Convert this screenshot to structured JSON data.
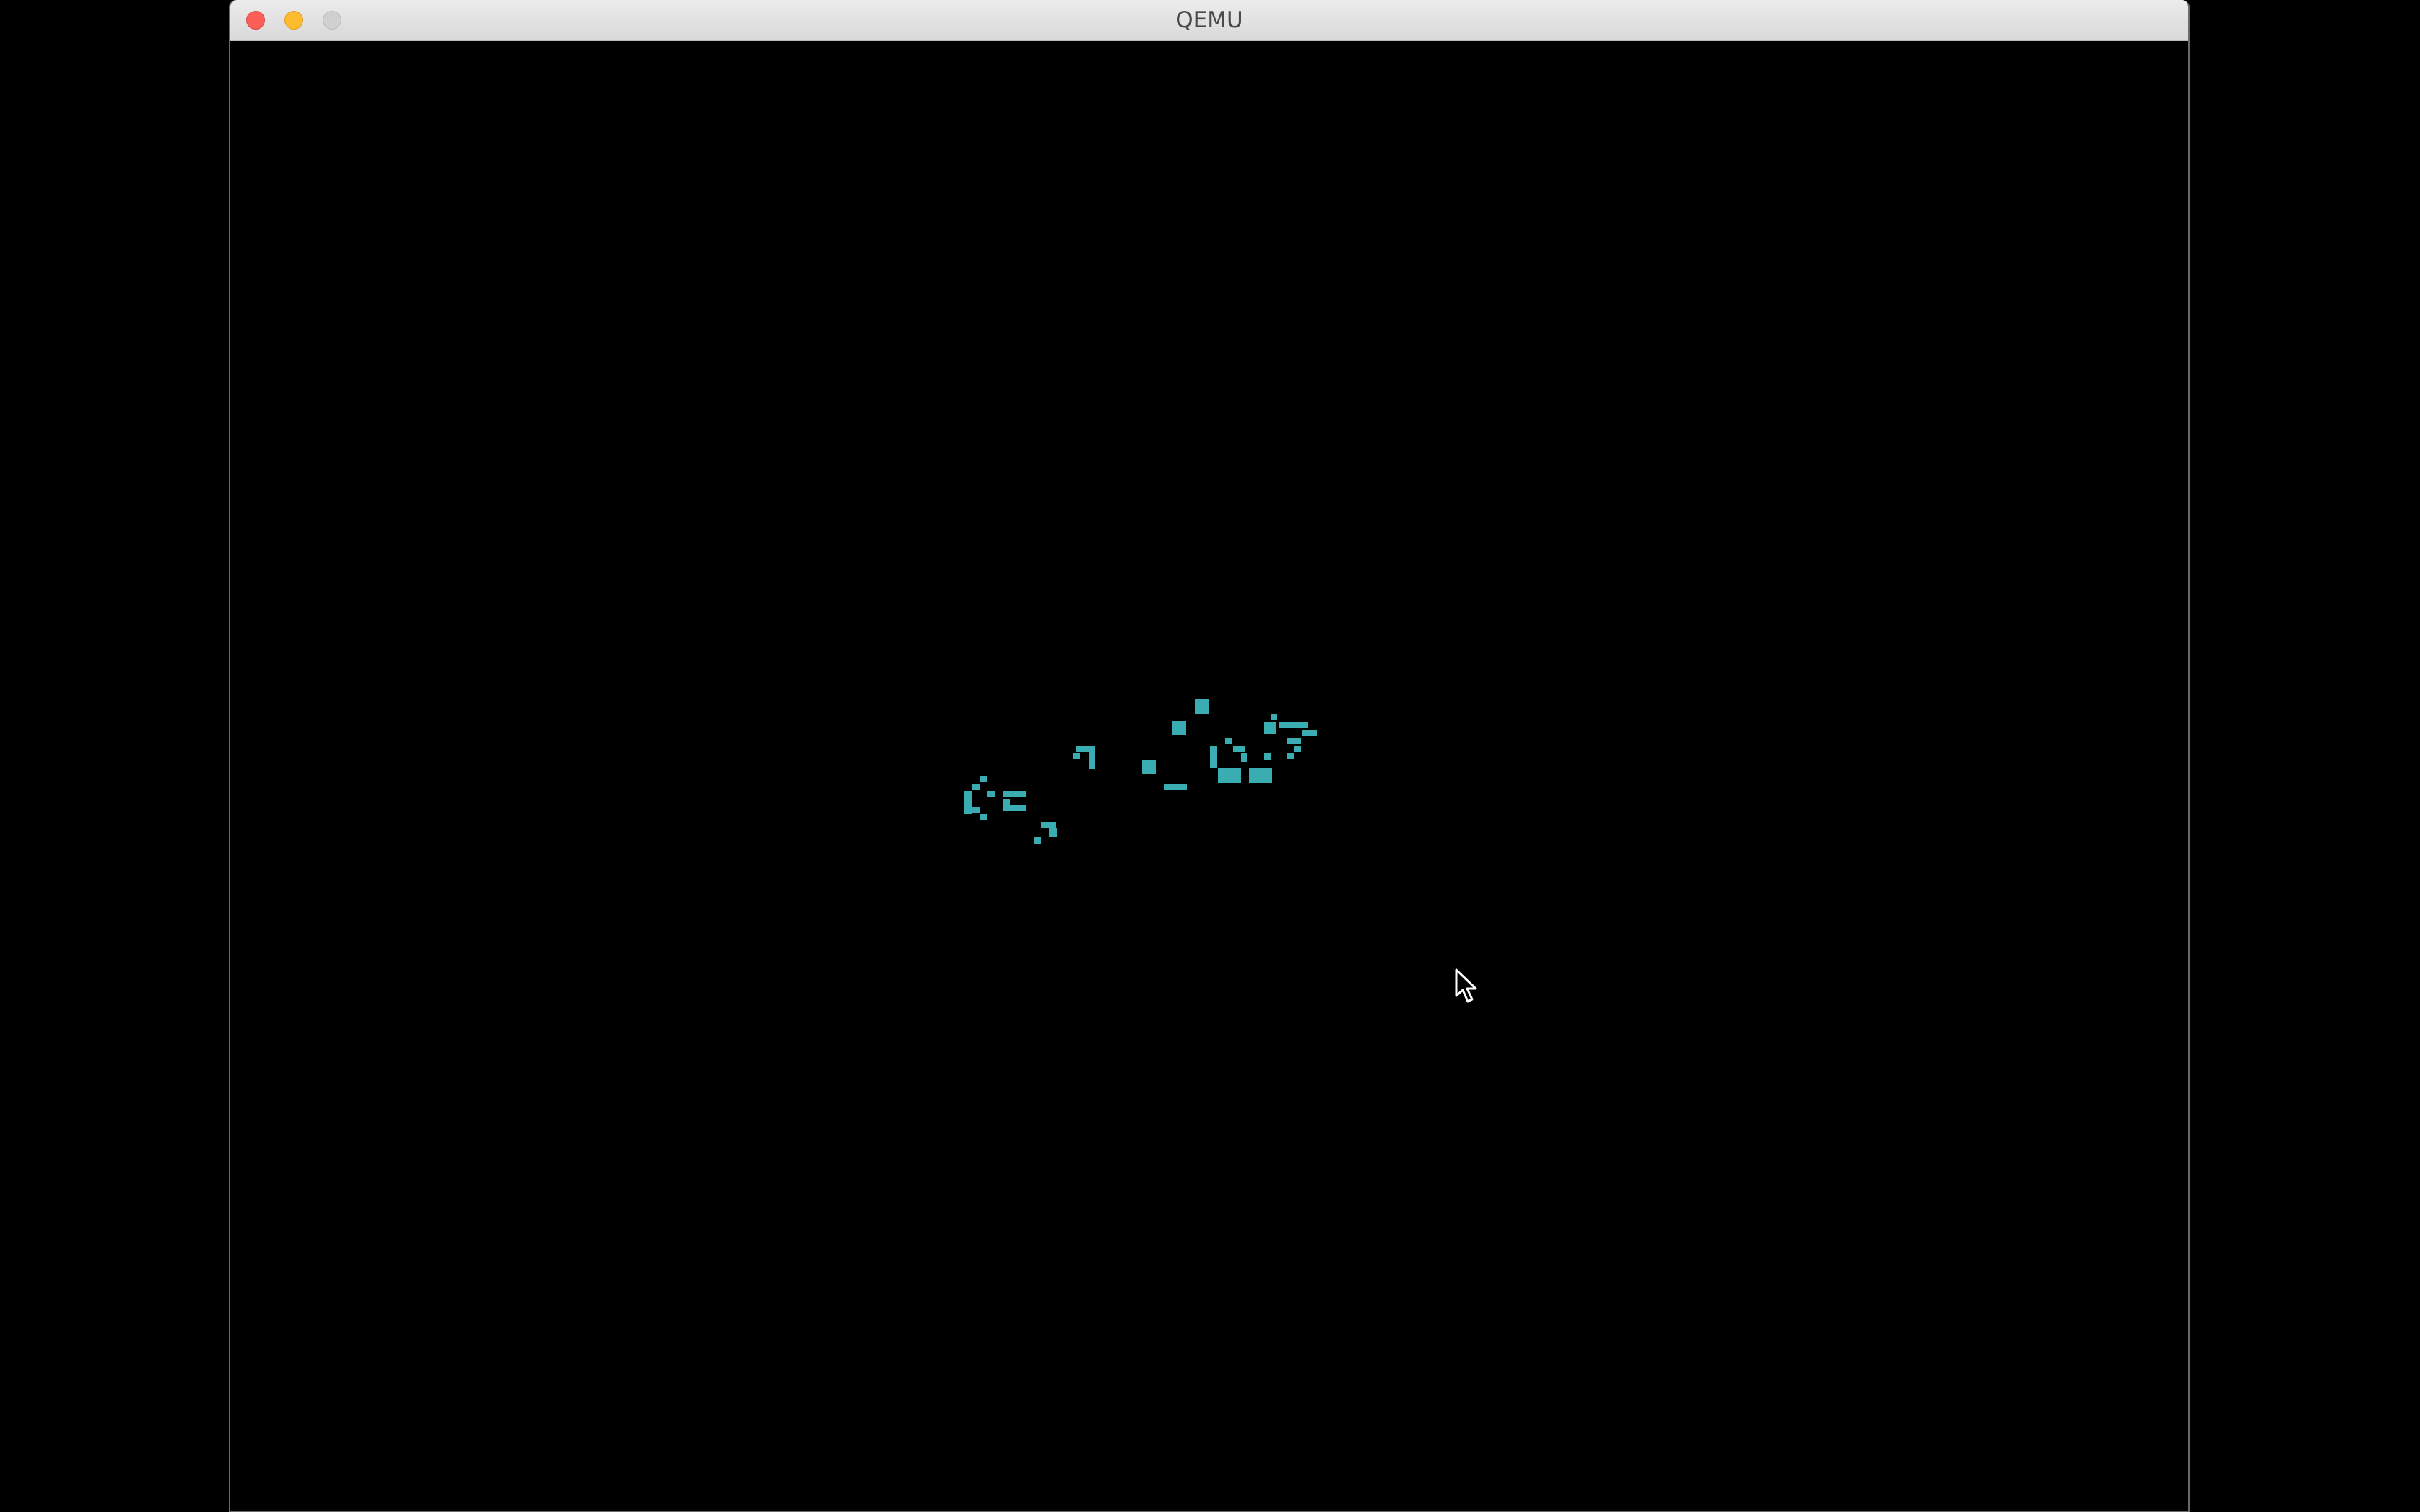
{
  "window": {
    "title": "QEMU"
  },
  "window_controls": {
    "close_color": "#fc5f57",
    "minimize_color": "#fdbc2e",
    "zoom_color": "#d0d0d0"
  },
  "screen": {
    "background": "#000000",
    "cell_color": "#3aadb3"
  },
  "icons": [
    "close-icon",
    "minimize-icon",
    "zoom-icon",
    "mouse-pointer-icon"
  ]
}
